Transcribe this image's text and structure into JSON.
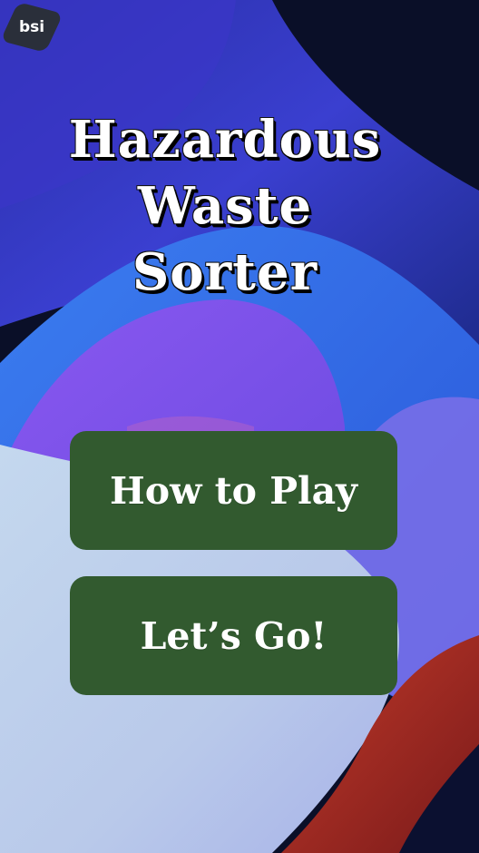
{
  "logo": {
    "text": "bsi",
    "icon": "bsi-logo"
  },
  "title": {
    "line1": "Hazardous",
    "line2": "Waste",
    "line3": "Sorter"
  },
  "buttons": {
    "how_to_play": "How to Play",
    "lets_go": "Let’s Go!"
  },
  "colors": {
    "button_bg": "#325a2f",
    "button_text": "#ffffff",
    "title_text": "#ffffff",
    "background_dark": "#0b1030"
  }
}
